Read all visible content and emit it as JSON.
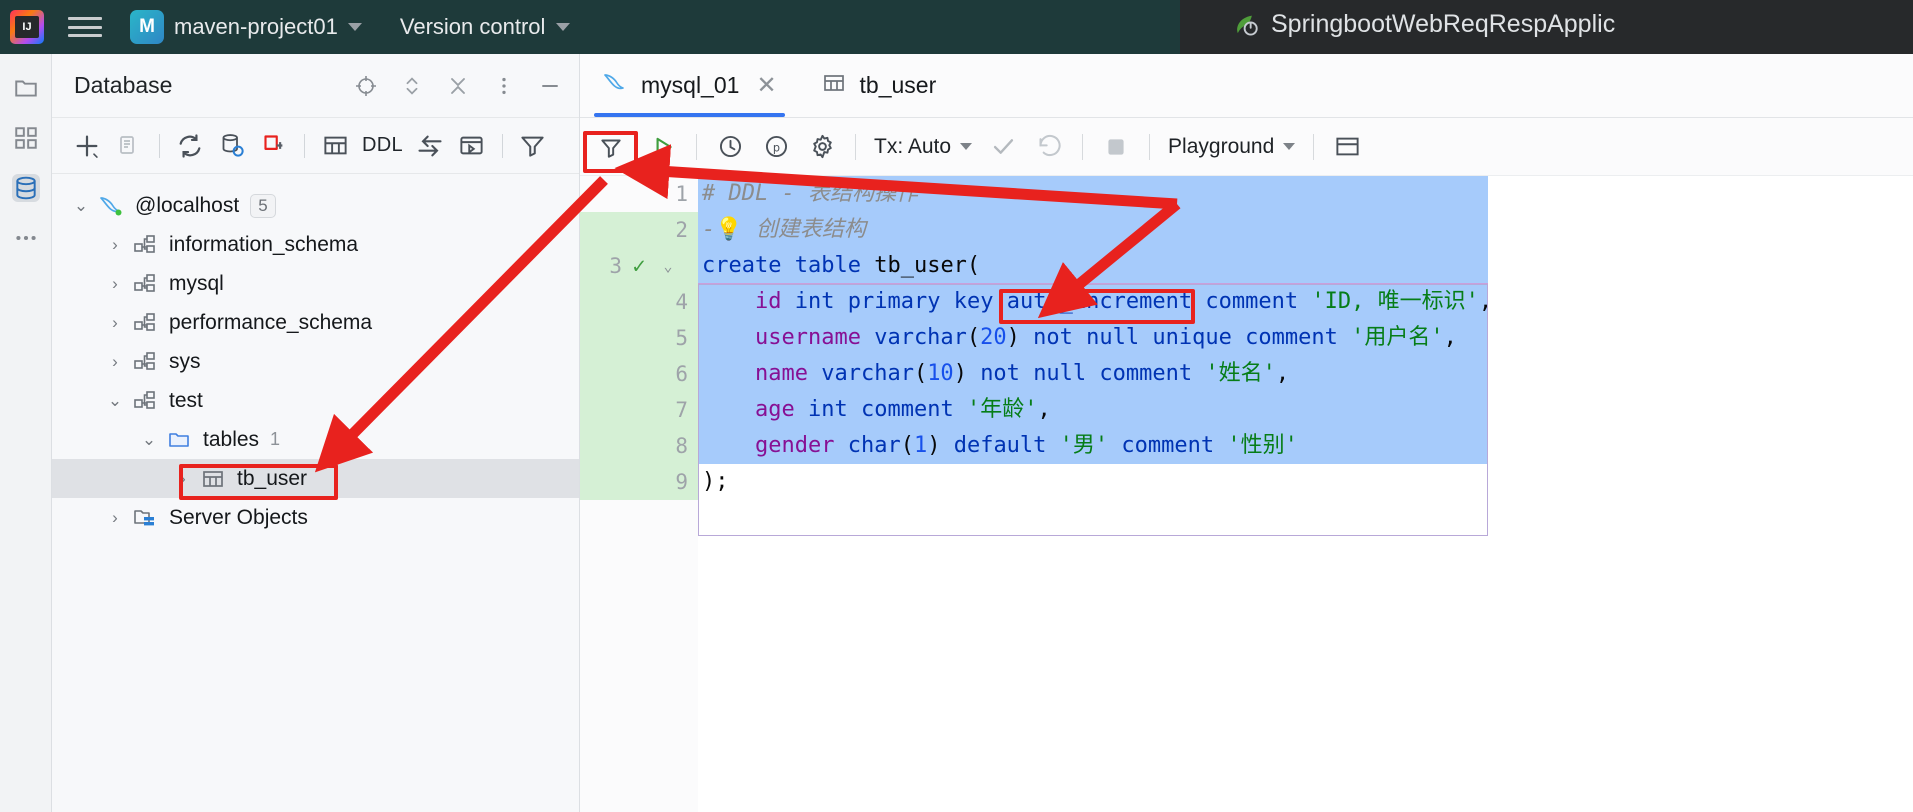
{
  "titlebar": {
    "ide_logo": "intellij-idea-logo",
    "menu_icon": "hamburger-menu-icon",
    "project_initial": "M",
    "project_name": "maven-project01",
    "project_dropdown_icon": "chevron-down-icon",
    "vcs_label": "Version control",
    "vcs_dropdown_icon": "chevron-down-icon",
    "run_config_icon": "spring-boot-leaf-icon",
    "run_config_name": "SpringbootWebReqRespApplic"
  },
  "rail": {
    "items": [
      {
        "name": "project-files-icon",
        "label": "Project"
      },
      {
        "name": "structure-icon",
        "label": "Structure"
      },
      {
        "name": "database-icon",
        "label": "Database",
        "active": true
      },
      {
        "name": "more-tool-windows-icon",
        "label": "More"
      }
    ]
  },
  "database_panel": {
    "title": "Database",
    "header_actions": [
      {
        "name": "scroll-from-source-icon",
        "label": "Select Opened File"
      },
      {
        "name": "expand-collapse-icon",
        "label": "Expand/Collapse"
      },
      {
        "name": "collapse-all-icon",
        "label": "Collapse All"
      },
      {
        "name": "options-menu-icon",
        "label": "Options"
      },
      {
        "name": "hide-panel-icon",
        "label": "Hide"
      }
    ],
    "toolbar": [
      {
        "name": "add-data-source-button",
        "label": "New"
      },
      {
        "name": "duplicate-button",
        "label": "Duplicate"
      },
      {
        "name": "refresh-button",
        "label": "Refresh"
      },
      {
        "name": "data-source-properties-button",
        "label": "Data Source Properties"
      },
      {
        "name": "disconnect-button",
        "label": "Disconnect"
      },
      {
        "name": "jump-to-table-button",
        "label": "Table"
      },
      {
        "name": "ddl-button",
        "label": "DDL"
      },
      {
        "name": "data-transfer-button",
        "label": "Import/Export"
      },
      {
        "name": "open-console-button",
        "label": "Open Console"
      },
      {
        "name": "filter-button",
        "label": "Filter"
      }
    ],
    "tree": [
      {
        "label": "@localhost",
        "icon": "mysql-dolphin-icon",
        "twisty": "expanded",
        "indent": 1,
        "badge": "5",
        "selected": false
      },
      {
        "label": "information_schema",
        "icon": "schema-icon",
        "twisty": "collapsed",
        "indent": 2,
        "selected": false
      },
      {
        "label": "mysql",
        "icon": "schema-icon",
        "twisty": "collapsed",
        "indent": 2,
        "selected": false
      },
      {
        "label": "performance_schema",
        "icon": "schema-icon",
        "twisty": "collapsed",
        "indent": 2,
        "selected": false
      },
      {
        "label": "sys",
        "icon": "schema-icon",
        "twisty": "collapsed",
        "indent": 2,
        "selected": false
      },
      {
        "label": "test",
        "icon": "schema-icon",
        "twisty": "expanded",
        "indent": 2,
        "selected": false
      },
      {
        "label": "tables",
        "icon": "folder-icon",
        "twisty": "expanded",
        "indent": 3,
        "count": "1",
        "selected": false
      },
      {
        "label": "tb_user",
        "icon": "table-icon",
        "twisty": "collapsed",
        "indent": 4,
        "selected": true,
        "annotated": true
      },
      {
        "label": "Server Objects",
        "icon": "server-objects-icon",
        "twisty": "collapsed",
        "indent": 2,
        "selected": false
      }
    ]
  },
  "editor": {
    "tabs": [
      {
        "label": "mysql_01",
        "icon": "mysql-dolphin-icon",
        "active": true,
        "closeable": true,
        "close_icon": "close-icon"
      },
      {
        "label": "tb_user",
        "icon": "table-icon",
        "active": false,
        "closeable": false
      }
    ],
    "toolbar": {
      "filter_icon": "filter-icon",
      "run_button": {
        "name": "execute-button",
        "icon": "run-triangle-icon",
        "annotated": true
      },
      "history_icon": "history-clock-icon",
      "parameters_icon": "parameters-p-icon",
      "settings_icon": "gear-icon",
      "tx_label": "Tx: Auto",
      "tx_dropdown_icon": "chevron-down-icon",
      "commit_icon": "commit-check-icon",
      "rollback_icon": "rollback-icon",
      "stop_icon": "stop-square-icon",
      "schema_label": "Playground",
      "schema_dropdown_icon": "chevron-down-icon",
      "grid_icon": "grid-view-icon"
    },
    "code": {
      "line_numbers": [
        "1",
        "2",
        "3",
        "4",
        "5",
        "6",
        "7",
        "8",
        "9"
      ],
      "executed_marker_line": 3,
      "executed_marker_icon": "green-check-icon",
      "fold_marker_icon": "chevron-down-icon",
      "lines": [
        {
          "n": 1,
          "tokens": [
            {
              "t": "# DDL - 表结构操作",
              "c": "cmt"
            }
          ]
        },
        {
          "n": 2,
          "tokens": [
            {
              "t": "-",
              "c": "cmt"
            },
            {
              "t": "💡",
              "c": "bulb"
            },
            {
              "t": " 创建表结构",
              "c": "cmt"
            }
          ]
        },
        {
          "n": 3,
          "tokens": [
            {
              "t": "create",
              "c": "kw"
            },
            {
              "t": " ",
              "c": "plain"
            },
            {
              "t": "table",
              "c": "kw"
            },
            {
              "t": " tb_user(",
              "c": "plain"
            }
          ]
        },
        {
          "n": 4,
          "tokens": [
            {
              "t": "    ",
              "c": "plain"
            },
            {
              "t": "id",
              "c": "id-pink"
            },
            {
              "t": " ",
              "c": "plain"
            },
            {
              "t": "int",
              "c": "kw"
            },
            {
              "t": " ",
              "c": "plain"
            },
            {
              "t": "primary",
              "c": "kw"
            },
            {
              "t": " ",
              "c": "plain"
            },
            {
              "t": "key",
              "c": "kw"
            },
            {
              "t": " ",
              "c": "plain"
            },
            {
              "t": "auto_increment",
              "c": "kw"
            },
            {
              "t": " ",
              "c": "plain"
            },
            {
              "t": "comment",
              "c": "kw"
            },
            {
              "t": " ",
              "c": "plain"
            },
            {
              "t": "'ID, 唯一标识'",
              "c": "str"
            },
            {
              "t": ",",
              "c": "plain"
            }
          ]
        },
        {
          "n": 5,
          "tokens": [
            {
              "t": "    ",
              "c": "plain"
            },
            {
              "t": "username",
              "c": "id-pink"
            },
            {
              "t": " ",
              "c": "plain"
            },
            {
              "t": "varchar",
              "c": "kw"
            },
            {
              "t": "(",
              "c": "plain"
            },
            {
              "t": "20",
              "c": "num"
            },
            {
              "t": ") ",
              "c": "plain"
            },
            {
              "t": "not",
              "c": "kw"
            },
            {
              "t": " ",
              "c": "plain"
            },
            {
              "t": "null",
              "c": "kw"
            },
            {
              "t": " ",
              "c": "plain"
            },
            {
              "t": "unique",
              "c": "kw"
            },
            {
              "t": " ",
              "c": "plain"
            },
            {
              "t": "comment",
              "c": "kw"
            },
            {
              "t": " ",
              "c": "plain"
            },
            {
              "t": "'用户名'",
              "c": "str"
            },
            {
              "t": ",",
              "c": "plain"
            }
          ]
        },
        {
          "n": 6,
          "tokens": [
            {
              "t": "    ",
              "c": "plain"
            },
            {
              "t": "name",
              "c": "id-pink"
            },
            {
              "t": " ",
              "c": "plain"
            },
            {
              "t": "varchar",
              "c": "kw"
            },
            {
              "t": "(",
              "c": "plain"
            },
            {
              "t": "10",
              "c": "num"
            },
            {
              "t": ") ",
              "c": "plain"
            },
            {
              "t": "not",
              "c": "kw"
            },
            {
              "t": " ",
              "c": "plain"
            },
            {
              "t": "null",
              "c": "kw"
            },
            {
              "t": " ",
              "c": "plain"
            },
            {
              "t": "comment",
              "c": "kw"
            },
            {
              "t": " ",
              "c": "plain"
            },
            {
              "t": "'姓名'",
              "c": "str"
            },
            {
              "t": ",",
              "c": "plain"
            }
          ]
        },
        {
          "n": 7,
          "tokens": [
            {
              "t": "    ",
              "c": "plain"
            },
            {
              "t": "age",
              "c": "id-pink"
            },
            {
              "t": " ",
              "c": "plain"
            },
            {
              "t": "int",
              "c": "kw"
            },
            {
              "t": " ",
              "c": "plain"
            },
            {
              "t": "comment",
              "c": "kw"
            },
            {
              "t": " ",
              "c": "plain"
            },
            {
              "t": "'年龄'",
              "c": "str"
            },
            {
              "t": ",",
              "c": "plain"
            }
          ]
        },
        {
          "n": 8,
          "tokens": [
            {
              "t": "    ",
              "c": "plain"
            },
            {
              "t": "gender",
              "c": "id-pink"
            },
            {
              "t": " ",
              "c": "plain"
            },
            {
              "t": "char",
              "c": "kw"
            },
            {
              "t": "(",
              "c": "plain"
            },
            {
              "t": "1",
              "c": "num"
            },
            {
              "t": ") ",
              "c": "plain"
            },
            {
              "t": "default",
              "c": "kw"
            },
            {
              "t": " ",
              "c": "plain"
            },
            {
              "t": "'男'",
              "c": "str"
            },
            {
              "t": " ",
              "c": "plain"
            },
            {
              "t": "comment",
              "c": "kw"
            },
            {
              "t": " ",
              "c": "plain"
            },
            {
              "t": "'性别'",
              "c": "str"
            }
          ]
        },
        {
          "n": 9,
          "tokens": [
            {
              "t": ");",
              "c": "plain"
            }
          ]
        }
      ]
    }
  },
  "annotations": {
    "color": "#e8221e",
    "boxes": [
      {
        "name": "run-button-highlight",
        "target": "execute-button"
      },
      {
        "name": "tb-user-tree-highlight",
        "target": "tree-item-tb_user"
      },
      {
        "name": "auto-increment-highlight",
        "target": "auto_increment-keyword"
      }
    ],
    "arrows": [
      {
        "name": "arrow-run-to-tb-user",
        "from": "run-button",
        "to": "tb_user-tree-item"
      },
      {
        "name": "arrow-auto-increment-to-run",
        "from": "auto_increment",
        "to": "run-button"
      }
    ]
  },
  "colors": {
    "accent_blue": "#3574f0",
    "annotation_red": "#e8221e",
    "selection_blue": "#a6cbfb",
    "gutter_green": "#d5f0d5",
    "titlebar_dark": "#27292b",
    "keyword_blue": "#0033b3",
    "string_green": "#067d17",
    "identifier_purple": "#871094"
  }
}
